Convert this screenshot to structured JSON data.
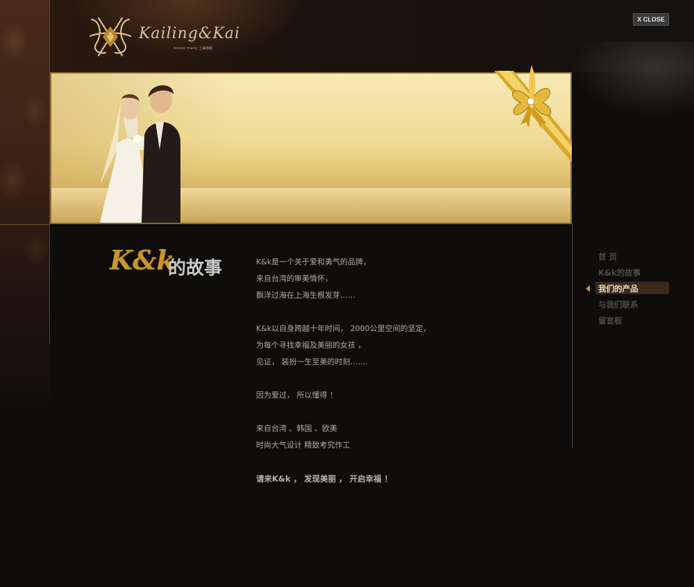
{
  "header": {
    "logo_text": "Kailing&Kai",
    "logo_subtitle": "forever marry 上海旗舰",
    "close_label": "X CLOSE"
  },
  "story": {
    "title_kk": "K&k",
    "title_zh": "的故事",
    "paragraphs": [
      [
        "K&k是一个关于爱和勇气的品牌，",
        "来自台湾的审美情怀，",
        "飘洋过海在上海生根发芽……"
      ],
      [
        "K&k以自身跨越十年时间，  2000公里空间的坚定，",
        "为每个寻找幸福及美丽的女孩   ，",
        "见证，  装扮一生至美的时刻……."
      ],
      [
        "因为爱过，  所以懂得  ！"
      ],
      [
        "来自台湾   、韩国   、欧美",
        "时尚大气设计  精致考究作工"
      ],
      [
        "请来K&k  ，  发现美丽  ，  开启幸福  ！"
      ]
    ]
  },
  "nav": {
    "items": [
      {
        "label": "首    页"
      },
      {
        "label": "K&k的故事"
      },
      {
        "label": "我们的产品"
      },
      {
        "label": "与我们联系"
      },
      {
        "label": "留言板"
      }
    ],
    "active_index": 2
  },
  "colors": {
    "gold": "#c9962e",
    "background": "#0e0d0c",
    "text": "#b0a8a0",
    "nav_inactive": "#4e4a46",
    "nav_active": "#e8dcc8"
  }
}
